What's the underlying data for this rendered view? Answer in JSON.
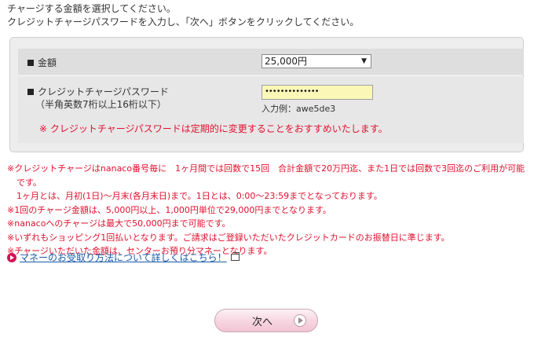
{
  "intro": {
    "line1": "チャージする金額を選択してください。",
    "line2": "クレジットチャージパスワードを入力し、「次へ」ボタンをクリックしてください。"
  },
  "form": {
    "amount_label": "金額",
    "amount_selected": "25,000円",
    "password_label": "クレジットチャージパスワード",
    "password_hint": "（半角英数7桁以上16桁以下）",
    "password_value": "••••••••••••••",
    "example": "入力例：awe5de3",
    "advice": "※ クレジットチャージパスワードは定期的に変更することをおすすめいたします。"
  },
  "notes": [
    "※クレジットチャージはnanaco番号毎に　1ヶ月間では回数で15回　合計金額で20万円迄、また1日では回数で3回迄のご利用が可能",
    "です。",
    "1ヶ月とは、月初(1日)～月末(各月末日)まで。1日とは、0:00～23:59までとなっております。",
    "※1回のチャージ金額は、5,000円以上、1,000円単位で29,000円までとなります。",
    "※nanacoへのチャージは最大で50,000円まで可能です。",
    "※いずれもショッピング1回払いとなります。ご請求はご登録いただいたクレジットカードのお振替日に準じます。",
    "※チャージいただいた金額は、センターお預り分マネーとなります。"
  ],
  "link": {
    "text": "マネーのお受取り方法について詳しくはこちら！"
  },
  "buttons": {
    "next_label": "次へ"
  },
  "colors": {
    "notice_red": "#e0102e",
    "link_blue": "#1a5aa8",
    "accent_pink": "#d31157"
  }
}
